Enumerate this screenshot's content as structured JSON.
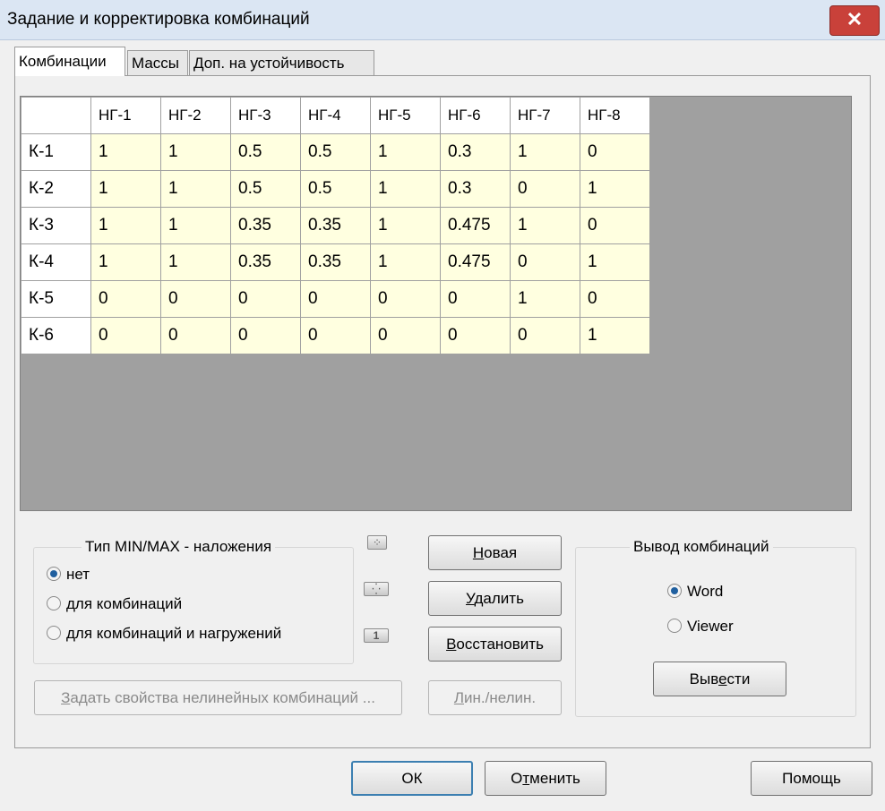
{
  "window": {
    "title": "Задание и корректировка комбинаций",
    "close_glyph": "✕"
  },
  "tabs": [
    {
      "label": "Комбинации",
      "active": true
    },
    {
      "label": "Массы",
      "active": false
    },
    {
      "label": "Доп. на устойчивость",
      "active": false
    }
  ],
  "grid": {
    "columns": [
      "НГ-1",
      "НГ-2",
      "НГ-3",
      "НГ-4",
      "НГ-5",
      "НГ-6",
      "НГ-7",
      "НГ-8"
    ],
    "rows": [
      {
        "name": "К-1",
        "values": [
          "1",
          "1",
          "0.5",
          "0.5",
          "1",
          "0.3",
          "1",
          "0"
        ]
      },
      {
        "name": "К-2",
        "values": [
          "1",
          "1",
          "0.5",
          "0.5",
          "1",
          "0.3",
          "0",
          "1"
        ]
      },
      {
        "name": "К-3",
        "values": [
          "1",
          "1",
          "0.35",
          "0.35",
          "1",
          "0.475",
          "1",
          "0"
        ]
      },
      {
        "name": "К-4",
        "values": [
          "1",
          "1",
          "0.35",
          "0.35",
          "1",
          "0.475",
          "0",
          "1"
        ]
      },
      {
        "name": "К-5",
        "values": [
          "0",
          "0",
          "0",
          "0",
          "0",
          "0",
          "1",
          "0"
        ]
      },
      {
        "name": "К-6",
        "values": [
          "0",
          "0",
          "0",
          "0",
          "0",
          "0",
          "0",
          "1"
        ]
      }
    ]
  },
  "minmax": {
    "legend": "Тип   MIN/MAX - наложения",
    "options": [
      {
        "label": "нет",
        "selected": true
      },
      {
        "label": "для комбинаций",
        "selected": false
      },
      {
        "label": "для комбинаций и нагружений",
        "selected": false
      }
    ]
  },
  "side_icons": [
    "scatter-small-icon",
    "scatter-diagonal-icon",
    "number-one-icon"
  ],
  "side_icon_glyphs": [
    "⁘",
    "⁛",
    "1"
  ],
  "buttons": {
    "new": {
      "pre": "",
      "u": "Н",
      "post": "овая"
    },
    "delete": {
      "pre": "",
      "u": "У",
      "post": "далить"
    },
    "restore": {
      "pre": "",
      "u": "В",
      "post": "осстановить"
    },
    "nonlinear_props": {
      "pre": "",
      "u": "З",
      "post": "адать свойства нелинейных комбинаций ..."
    },
    "lin_nonlin": {
      "pre": "",
      "u": "Л",
      "post": "ин./нелин."
    },
    "output": {
      "pre": "Выв",
      "u": "е",
      "post": "сти"
    }
  },
  "output_group": {
    "legend": "Вывод  комбинаций",
    "options": [
      {
        "label": "Word",
        "selected": true
      },
      {
        "label": "Viewer",
        "selected": false
      }
    ]
  },
  "footer": {
    "ok": "ОК",
    "cancel": {
      "pre": "О",
      "u": "т",
      "post": "менить"
    },
    "help": "Помощь"
  }
}
